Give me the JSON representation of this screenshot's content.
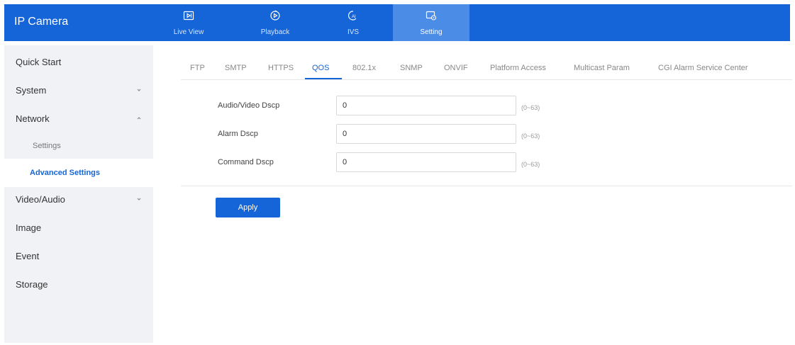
{
  "app": {
    "title": "IP Camera"
  },
  "topnav": [
    {
      "label": "Live View",
      "icon": "live-view-icon"
    },
    {
      "label": "Playback",
      "icon": "playback-icon"
    },
    {
      "label": "IVS",
      "icon": "ivs-ai-icon"
    },
    {
      "label": "Setting",
      "icon": "setting-icon",
      "active": true
    }
  ],
  "sidebar": {
    "items": [
      {
        "label": "Quick Start"
      },
      {
        "label": "System",
        "chevron": "down"
      },
      {
        "label": "Network",
        "chevron": "up"
      },
      {
        "label": "Settings",
        "sub": true
      },
      {
        "label": "Advanced Settings",
        "sub": true,
        "active": true
      },
      {
        "label": "Video/Audio",
        "chevron": "down"
      },
      {
        "label": "Image"
      },
      {
        "label": "Event"
      },
      {
        "label": "Storage"
      }
    ]
  },
  "tabs": [
    {
      "label": "FTP"
    },
    {
      "label": "SMTP"
    },
    {
      "label": "HTTPS"
    },
    {
      "label": "QOS",
      "active": true
    },
    {
      "label": "802.1x"
    },
    {
      "label": "SNMP"
    },
    {
      "label": "ONVIF"
    },
    {
      "label": "Platform Access"
    },
    {
      "label": "Multicast Param"
    },
    {
      "label": "CGI Alarm Service Center"
    }
  ],
  "form": {
    "fields": [
      {
        "label": "Audio/Video Dscp",
        "value": "0",
        "range": "(0~63)"
      },
      {
        "label": "Alarm Dscp",
        "value": "0",
        "range": "(0~63)"
      },
      {
        "label": "Command Dscp",
        "value": "0",
        "range": "(0~63)"
      }
    ]
  },
  "actions": {
    "apply_label": "Apply"
  },
  "colors": {
    "brand": "#1565d8",
    "sidebar_bg": "#f0f2f5",
    "active_nav": "#4b8ce6"
  }
}
